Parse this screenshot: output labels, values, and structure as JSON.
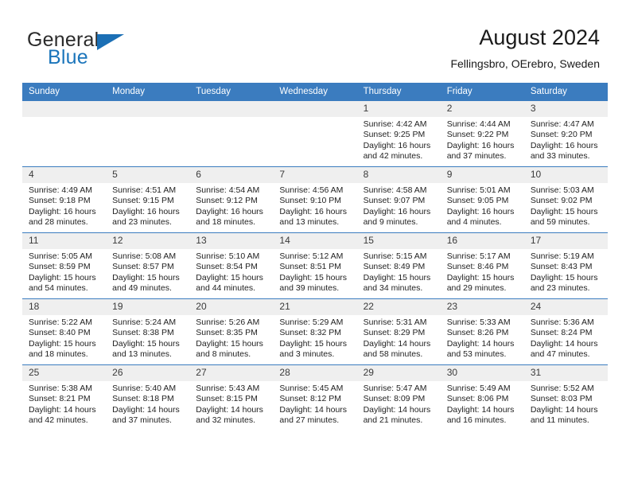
{
  "brand": {
    "word_one": "General",
    "word_two": "Blue",
    "accent_color": "#1b75bb",
    "triangle_icon": "brand-triangle-icon"
  },
  "header": {
    "title": "August 2024",
    "subtitle": "Fellingsbro, OErebro, Sweden"
  },
  "calendar": {
    "header_bg": "#3b7cbf",
    "daynum_bg": "#efefef",
    "weekday_headers": [
      "Sunday",
      "Monday",
      "Tuesday",
      "Wednesday",
      "Thursday",
      "Friday",
      "Saturday"
    ],
    "weeks": [
      [
        {
          "day": "",
          "lines": []
        },
        {
          "day": "",
          "lines": []
        },
        {
          "day": "",
          "lines": []
        },
        {
          "day": "",
          "lines": []
        },
        {
          "day": "1",
          "lines": [
            "Sunrise: 4:42 AM",
            "Sunset: 9:25 PM",
            "Daylight: 16 hours",
            "and 42 minutes."
          ]
        },
        {
          "day": "2",
          "lines": [
            "Sunrise: 4:44 AM",
            "Sunset: 9:22 PM",
            "Daylight: 16 hours",
            "and 37 minutes."
          ]
        },
        {
          "day": "3",
          "lines": [
            "Sunrise: 4:47 AM",
            "Sunset: 9:20 PM",
            "Daylight: 16 hours",
            "and 33 minutes."
          ]
        }
      ],
      [
        {
          "day": "4",
          "lines": [
            "Sunrise: 4:49 AM",
            "Sunset: 9:18 PM",
            "Daylight: 16 hours",
            "and 28 minutes."
          ]
        },
        {
          "day": "5",
          "lines": [
            "Sunrise: 4:51 AM",
            "Sunset: 9:15 PM",
            "Daylight: 16 hours",
            "and 23 minutes."
          ]
        },
        {
          "day": "6",
          "lines": [
            "Sunrise: 4:54 AM",
            "Sunset: 9:12 PM",
            "Daylight: 16 hours",
            "and 18 minutes."
          ]
        },
        {
          "day": "7",
          "lines": [
            "Sunrise: 4:56 AM",
            "Sunset: 9:10 PM",
            "Daylight: 16 hours",
            "and 13 minutes."
          ]
        },
        {
          "day": "8",
          "lines": [
            "Sunrise: 4:58 AM",
            "Sunset: 9:07 PM",
            "Daylight: 16 hours",
            "and 9 minutes."
          ]
        },
        {
          "day": "9",
          "lines": [
            "Sunrise: 5:01 AM",
            "Sunset: 9:05 PM",
            "Daylight: 16 hours",
            "and 4 minutes."
          ]
        },
        {
          "day": "10",
          "lines": [
            "Sunrise: 5:03 AM",
            "Sunset: 9:02 PM",
            "Daylight: 15 hours",
            "and 59 minutes."
          ]
        }
      ],
      [
        {
          "day": "11",
          "lines": [
            "Sunrise: 5:05 AM",
            "Sunset: 8:59 PM",
            "Daylight: 15 hours",
            "and 54 minutes."
          ]
        },
        {
          "day": "12",
          "lines": [
            "Sunrise: 5:08 AM",
            "Sunset: 8:57 PM",
            "Daylight: 15 hours",
            "and 49 minutes."
          ]
        },
        {
          "day": "13",
          "lines": [
            "Sunrise: 5:10 AM",
            "Sunset: 8:54 PM",
            "Daylight: 15 hours",
            "and 44 minutes."
          ]
        },
        {
          "day": "14",
          "lines": [
            "Sunrise: 5:12 AM",
            "Sunset: 8:51 PM",
            "Daylight: 15 hours",
            "and 39 minutes."
          ]
        },
        {
          "day": "15",
          "lines": [
            "Sunrise: 5:15 AM",
            "Sunset: 8:49 PM",
            "Daylight: 15 hours",
            "and 34 minutes."
          ]
        },
        {
          "day": "16",
          "lines": [
            "Sunrise: 5:17 AM",
            "Sunset: 8:46 PM",
            "Daylight: 15 hours",
            "and 29 minutes."
          ]
        },
        {
          "day": "17",
          "lines": [
            "Sunrise: 5:19 AM",
            "Sunset: 8:43 PM",
            "Daylight: 15 hours",
            "and 23 minutes."
          ]
        }
      ],
      [
        {
          "day": "18",
          "lines": [
            "Sunrise: 5:22 AM",
            "Sunset: 8:40 PM",
            "Daylight: 15 hours",
            "and 18 minutes."
          ]
        },
        {
          "day": "19",
          "lines": [
            "Sunrise: 5:24 AM",
            "Sunset: 8:38 PM",
            "Daylight: 15 hours",
            "and 13 minutes."
          ]
        },
        {
          "day": "20",
          "lines": [
            "Sunrise: 5:26 AM",
            "Sunset: 8:35 PM",
            "Daylight: 15 hours",
            "and 8 minutes."
          ]
        },
        {
          "day": "21",
          "lines": [
            "Sunrise: 5:29 AM",
            "Sunset: 8:32 PM",
            "Daylight: 15 hours",
            "and 3 minutes."
          ]
        },
        {
          "day": "22",
          "lines": [
            "Sunrise: 5:31 AM",
            "Sunset: 8:29 PM",
            "Daylight: 14 hours",
            "and 58 minutes."
          ]
        },
        {
          "day": "23",
          "lines": [
            "Sunrise: 5:33 AM",
            "Sunset: 8:26 PM",
            "Daylight: 14 hours",
            "and 53 minutes."
          ]
        },
        {
          "day": "24",
          "lines": [
            "Sunrise: 5:36 AM",
            "Sunset: 8:24 PM",
            "Daylight: 14 hours",
            "and 47 minutes."
          ]
        }
      ],
      [
        {
          "day": "25",
          "lines": [
            "Sunrise: 5:38 AM",
            "Sunset: 8:21 PM",
            "Daylight: 14 hours",
            "and 42 minutes."
          ]
        },
        {
          "day": "26",
          "lines": [
            "Sunrise: 5:40 AM",
            "Sunset: 8:18 PM",
            "Daylight: 14 hours",
            "and 37 minutes."
          ]
        },
        {
          "day": "27",
          "lines": [
            "Sunrise: 5:43 AM",
            "Sunset: 8:15 PM",
            "Daylight: 14 hours",
            "and 32 minutes."
          ]
        },
        {
          "day": "28",
          "lines": [
            "Sunrise: 5:45 AM",
            "Sunset: 8:12 PM",
            "Daylight: 14 hours",
            "and 27 minutes."
          ]
        },
        {
          "day": "29",
          "lines": [
            "Sunrise: 5:47 AM",
            "Sunset: 8:09 PM",
            "Daylight: 14 hours",
            "and 21 minutes."
          ]
        },
        {
          "day": "30",
          "lines": [
            "Sunrise: 5:49 AM",
            "Sunset: 8:06 PM",
            "Daylight: 14 hours",
            "and 16 minutes."
          ]
        },
        {
          "day": "31",
          "lines": [
            "Sunrise: 5:52 AM",
            "Sunset: 8:03 PM",
            "Daylight: 14 hours",
            "and 11 minutes."
          ]
        }
      ]
    ]
  }
}
